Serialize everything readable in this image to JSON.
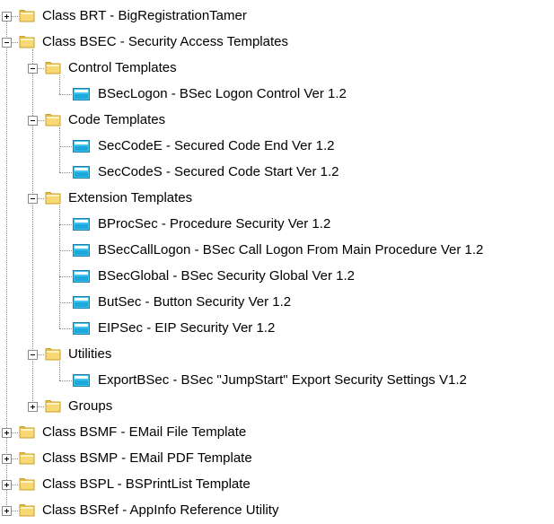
{
  "tree": {
    "nodes": [
      {
        "label": "Class BRT - BigRegistrationTamer",
        "kind": "folder",
        "level": 0,
        "expander": "plus"
      },
      {
        "label": "Class BSEC - Security Access Templates",
        "kind": "folder",
        "level": 0,
        "expander": "minus"
      },
      {
        "label": "Control Templates",
        "kind": "folder",
        "level": 1,
        "expander": "minus"
      },
      {
        "label": "BSecLogon - BSec Logon Control Ver 1.2",
        "kind": "template",
        "level": 2,
        "expander": "none"
      },
      {
        "label": "Code Templates",
        "kind": "folder",
        "level": 1,
        "expander": "minus"
      },
      {
        "label": "SecCodeE - Secured Code End Ver 1.2",
        "kind": "template",
        "level": 2,
        "expander": "none"
      },
      {
        "label": "SecCodeS - Secured Code Start Ver 1.2",
        "kind": "template",
        "level": 2,
        "expander": "none"
      },
      {
        "label": "Extension Templates",
        "kind": "folder",
        "level": 1,
        "expander": "minus"
      },
      {
        "label": "BProcSec - Procedure Security Ver 1.2",
        "kind": "template",
        "level": 2,
        "expander": "none"
      },
      {
        "label": "BSecCallLogon - BSec Call Logon From Main Procedure Ver 1.2",
        "kind": "template",
        "level": 2,
        "expander": "none"
      },
      {
        "label": "BSecGlobal - BSec Security Global Ver 1.2",
        "kind": "template",
        "level": 2,
        "expander": "none"
      },
      {
        "label": "ButSec - Button Security Ver 1.2",
        "kind": "template",
        "level": 2,
        "expander": "none"
      },
      {
        "label": "EIPSec - EIP Security Ver 1.2",
        "kind": "template",
        "level": 2,
        "expander": "none"
      },
      {
        "label": "Utilities",
        "kind": "folder",
        "level": 1,
        "expander": "minus"
      },
      {
        "label": "ExportBSec - BSec \"JumpStart\" Export Security Settings V1.2",
        "kind": "template",
        "level": 2,
        "expander": "none"
      },
      {
        "label": "Groups",
        "kind": "folder",
        "level": 1,
        "expander": "plus"
      },
      {
        "label": "Class BSMF - EMail File Template",
        "kind": "folder",
        "level": 0,
        "expander": "plus"
      },
      {
        "label": "Class BSMP - EMail PDF Template",
        "kind": "folder",
        "level": 0,
        "expander": "plus"
      },
      {
        "label": "Class BSPL - BSPrintList Template",
        "kind": "folder",
        "level": 0,
        "expander": "plus"
      },
      {
        "label": "Class BSRef - AppInfo Reference Utility",
        "kind": "folder",
        "level": 0,
        "expander": "plus"
      }
    ]
  },
  "icons": {
    "folder": "folder-icon",
    "template": "template-icon",
    "expand": "plus-icon",
    "collapse": "minus-icon"
  },
  "colors": {
    "folder_fill": "#f8d775",
    "folder_edge": "#c9a227",
    "template_fill": "#3fc3f0",
    "template_edge": "#1f7fa8",
    "tree_lines": "#8a8a8a"
  }
}
